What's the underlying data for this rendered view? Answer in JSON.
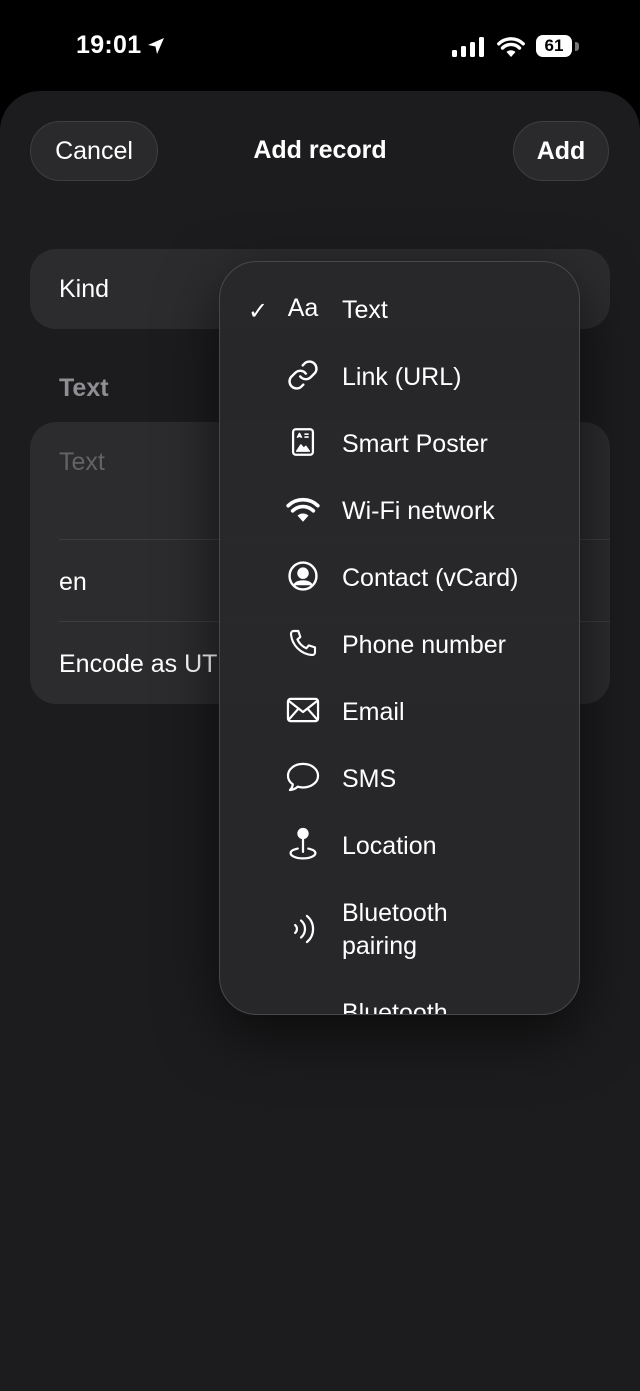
{
  "status_bar": {
    "time": "19:01",
    "battery": "61"
  },
  "header": {
    "cancel_label": "Cancel",
    "title": "Add record",
    "add_label": "Add"
  },
  "form": {
    "kind_label": "Kind",
    "section_title": "Text",
    "text_placeholder": "Text",
    "language_value": "en",
    "encode_label": "Encode as UT"
  },
  "menu": {
    "selected_index": 0,
    "items": [
      {
        "label": "Text",
        "icon": "text-format-icon",
        "glyph": "Aa"
      },
      {
        "label": "Link (URL)",
        "icon": "link-icon"
      },
      {
        "label": "Smart Poster",
        "icon": "smart-poster-icon"
      },
      {
        "label": "Wi-Fi network",
        "icon": "wifi-icon"
      },
      {
        "label": "Contact (vCard)",
        "icon": "contact-icon"
      },
      {
        "label": "Phone number",
        "icon": "phone-icon"
      },
      {
        "label": "Email",
        "icon": "envelope-icon"
      },
      {
        "label": "SMS",
        "icon": "message-bubble-icon"
      },
      {
        "label": "Location",
        "icon": "location-pin-icon"
      },
      {
        "label": "Bluetooth\npairing",
        "icon": "bluetooth-waves-icon"
      },
      {
        "label": "Bluetooth",
        "icon": "bluetooth-waves-icon"
      }
    ]
  }
}
